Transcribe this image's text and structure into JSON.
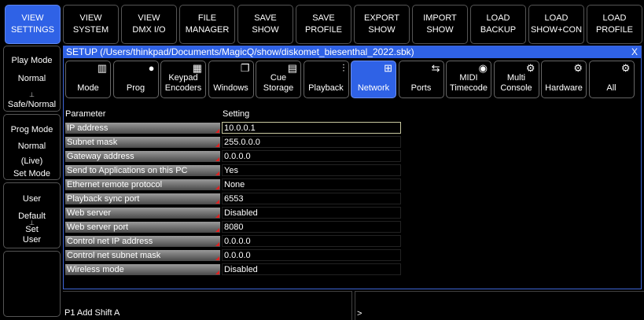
{
  "toolbar": [
    {
      "label": "VIEW\nSETTINGS",
      "name": "view-settings-button",
      "active": true
    },
    {
      "label": "VIEW\nSYSTEM",
      "name": "view-system-button"
    },
    {
      "label": "VIEW\nDMX I/O",
      "name": "view-dmx-io-button"
    },
    {
      "label": "FILE\nMANAGER",
      "name": "file-manager-button"
    },
    {
      "label": "SAVE\nSHOW",
      "name": "save-show-button"
    },
    {
      "label": "SAVE\nPROFILE",
      "name": "save-profile-button"
    },
    {
      "label": "EXPORT\nSHOW",
      "name": "export-show-button"
    },
    {
      "label": "IMPORT\nSHOW",
      "name": "import-show-button"
    },
    {
      "label": "LOAD\nBACKUP",
      "name": "load-backup-button"
    },
    {
      "label": "LOAD\nSHOW+CON",
      "name": "load-show-con-button"
    },
    {
      "label": "LOAD\nPROFILE",
      "name": "load-profile-button"
    }
  ],
  "left": {
    "play": {
      "title": "Play Mode",
      "value": "Normal",
      "action": "Safe/Normal"
    },
    "prog": {
      "title": "Prog Mode",
      "value": "Normal",
      "sub": "(Live)",
      "action": "Set Mode"
    },
    "user": {
      "title": "User",
      "value": "Default",
      "action1": "Set",
      "action2": "User"
    }
  },
  "setup": {
    "title": "SETUP (/Users/thinkpad/Documents/MagicQ/show/diskomet_biesenthal_2022.sbk)",
    "close": "X",
    "tabs": [
      {
        "label": "Mode",
        "icon": "mode-icon",
        "glyph": "▥"
      },
      {
        "label": "Prog",
        "icon": "prog-icon",
        "glyph": "●"
      },
      {
        "label": "Keypad\nEncoders",
        "icon": "keypad-icon",
        "glyph": "▦"
      },
      {
        "label": "Windows",
        "icon": "windows-icon",
        "glyph": "❐"
      },
      {
        "label": "Cue\nStorage",
        "icon": "cue-storage-icon",
        "glyph": "▤"
      },
      {
        "label": "Playback",
        "icon": "playback-icon",
        "glyph": "⫶"
      },
      {
        "label": "Network",
        "icon": "network-icon",
        "glyph": "⊞",
        "active": true
      },
      {
        "label": "Ports",
        "icon": "ports-icon",
        "glyph": "⇆"
      },
      {
        "label": "MIDI\nTimecode",
        "icon": "midi-icon",
        "glyph": "◉"
      },
      {
        "label": "Multi\nConsole",
        "icon": "multi-console-icon",
        "glyph": "⚙"
      },
      {
        "label": "Hardware",
        "icon": "hardware-icon",
        "glyph": "⚙"
      },
      {
        "label": "All",
        "icon": "all-icon",
        "glyph": "⚙"
      }
    ],
    "headers": {
      "parameter": "Parameter",
      "setting": "Setting"
    },
    "rows": [
      {
        "param": "IP address",
        "value": "10.0.0.1",
        "selected": true
      },
      {
        "param": "Subnet mask",
        "value": "255.0.0.0"
      },
      {
        "param": "Gateway address",
        "value": "0.0.0.0"
      },
      {
        "param": "Send to Applications on this PC",
        "value": "Yes"
      },
      {
        "param": "Ethernet remote protocol",
        "value": "None"
      },
      {
        "param": "Playback sync port",
        "value": "6553"
      },
      {
        "param": "Web server",
        "value": "Disabled"
      },
      {
        "param": "Web server port",
        "value": "8080"
      },
      {
        "param": "Control net IP address",
        "value": "0.0.0.0"
      },
      {
        "param": "Control net subnet mask",
        "value": "0.0.0.0"
      },
      {
        "param": "Wireless mode",
        "value": "Disabled"
      }
    ]
  },
  "bottom": {
    "command": "P1  Add Shift A",
    "prompt": ">"
  },
  "colors": {
    "accent": "#2f62e6",
    "marker": "#e02020"
  }
}
